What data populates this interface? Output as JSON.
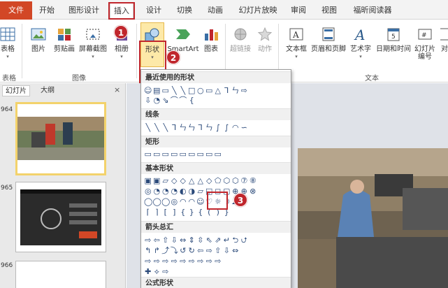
{
  "tabs": [
    "文件",
    "开始",
    "图形设计",
    "插入",
    "设计",
    "切换",
    "动画",
    "幻灯片放映",
    "审阅",
    "视图",
    "福昕阅读器"
  ],
  "ribbon": {
    "buttons": {
      "table": "表格",
      "picture": "图片",
      "clipart": "剪贴画",
      "screenshot": "屏幕截图",
      "album": "相册",
      "shapes": "形状",
      "smartart": "SmartArt",
      "chart": "图表",
      "hyperlink": "超链接",
      "action": "动作",
      "textbox": "文本框",
      "header_footer": "页眉和页脚",
      "wordart": "艺术字",
      "datetime": "日期和时间",
      "slide_number": "幻灯片编号",
      "obj": "对"
    },
    "groups": {
      "table": "表格",
      "images": "图像",
      "text": "文本"
    }
  },
  "badges": {
    "b1": "1",
    "b2": "2",
    "b3": "3"
  },
  "left_pane": {
    "tab_slides": "幻灯片",
    "tab_outline": "大纲",
    "close": "×",
    "slide_numbers": [
      "964",
      "965",
      "966"
    ]
  },
  "shapes_menu": {
    "recent": "最近使用的形状",
    "lines": "线条",
    "rect": "矩形",
    "basic": "基本形状",
    "arrows": "箭头总汇",
    "equation": "公式形状",
    "rows": {
      "recent1": "☺▤▭╲╲□○▭△⅂ㄣ⇨",
      "recent2": "⇩◔⇘⌒⌒{",
      "lines1": "╲╲╲⅂ㄣㄣ⅂ㄣ∫∫◠∽",
      "rect1": "▭▭▭▭▭▭▭▭▭",
      "basic1": "▣▣▱◇◇△△◇⬠⬡⬡⑦⑧",
      "basic2": "◎◔◔◔◐◑▱◱◻▢⊕⊕⊗",
      "basic3": "◯◯◯◎◠◠☺♡☼☽☁",
      "basic4": "⌈⌉[]{}{()}",
      "arrows1": "⇨⇦⇧⇩⇔⇕⇳⇖⇗↵⮌⮍",
      "arrows2": "↰↱⤴⤵↺↻⇦⇨⇧⇩⇔",
      "arrows3": "⇨⇨⇨⇨⇨⇨⇨⇨⇨",
      "arrows4": "✚⟡⇨"
    }
  }
}
